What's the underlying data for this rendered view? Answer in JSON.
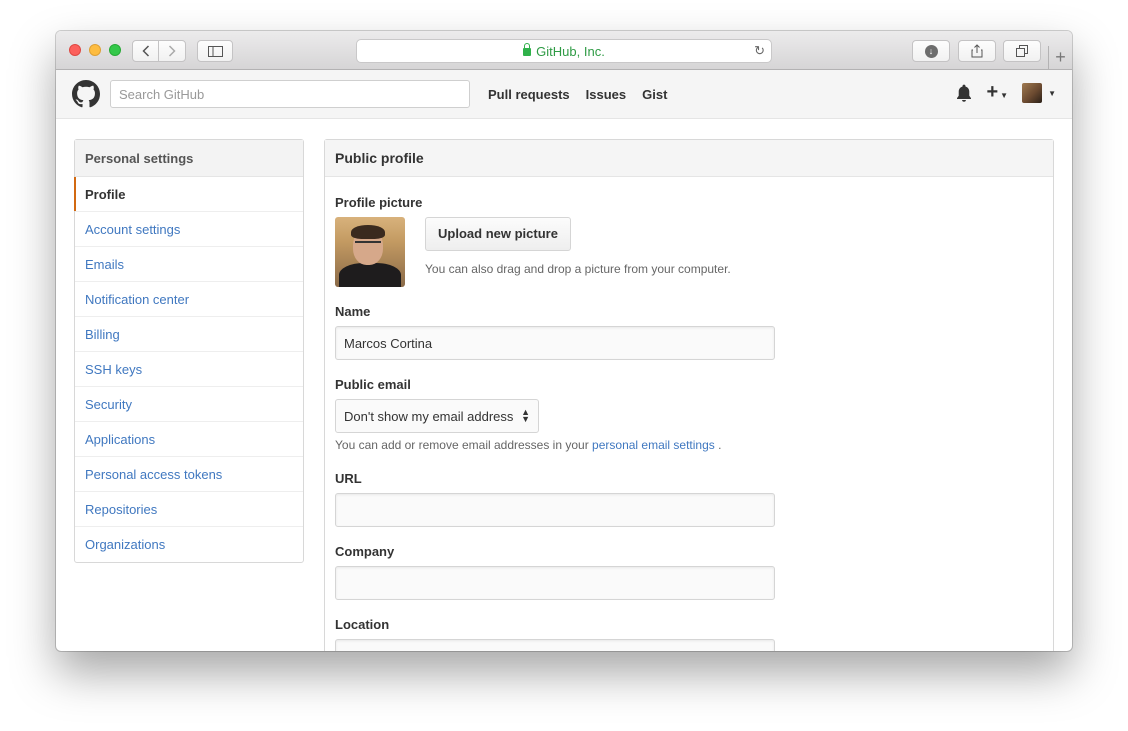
{
  "browser": {
    "address": "GitHub, Inc.",
    "back_icon": "chevron-left-icon",
    "forward_icon": "chevron-right-icon"
  },
  "header": {
    "search_placeholder": "Search GitHub",
    "nav": [
      "Pull requests",
      "Issues",
      "Gist"
    ]
  },
  "sidebar": {
    "heading": "Personal settings",
    "items": [
      {
        "label": "Profile",
        "selected": true
      },
      {
        "label": "Account settings"
      },
      {
        "label": "Emails"
      },
      {
        "label": "Notification center"
      },
      {
        "label": "Billing"
      },
      {
        "label": "SSH keys"
      },
      {
        "label": "Security"
      },
      {
        "label": "Applications"
      },
      {
        "label": "Personal access tokens"
      },
      {
        "label": "Repositories"
      },
      {
        "label": "Organizations"
      }
    ]
  },
  "profile": {
    "title": "Public profile",
    "picture_label": "Profile picture",
    "upload_label": "Upload new picture",
    "upload_hint": "You can also drag and drop a picture from your computer.",
    "name_label": "Name",
    "name_value": "Marcos Cortina",
    "email_label": "Public email",
    "email_selected": "Don't show my email address",
    "email_hint_prefix": "You can add or remove email addresses in your",
    "email_hint_link": "personal email settings",
    "email_hint_suffix": ".",
    "url_label": "URL",
    "url_value": "",
    "company_label": "Company",
    "company_value": "",
    "location_label": "Location",
    "location_value": ""
  },
  "colors": {
    "link": "#4078c0",
    "selected_accent": "#d26911",
    "secure_green": "#2f9b45"
  }
}
